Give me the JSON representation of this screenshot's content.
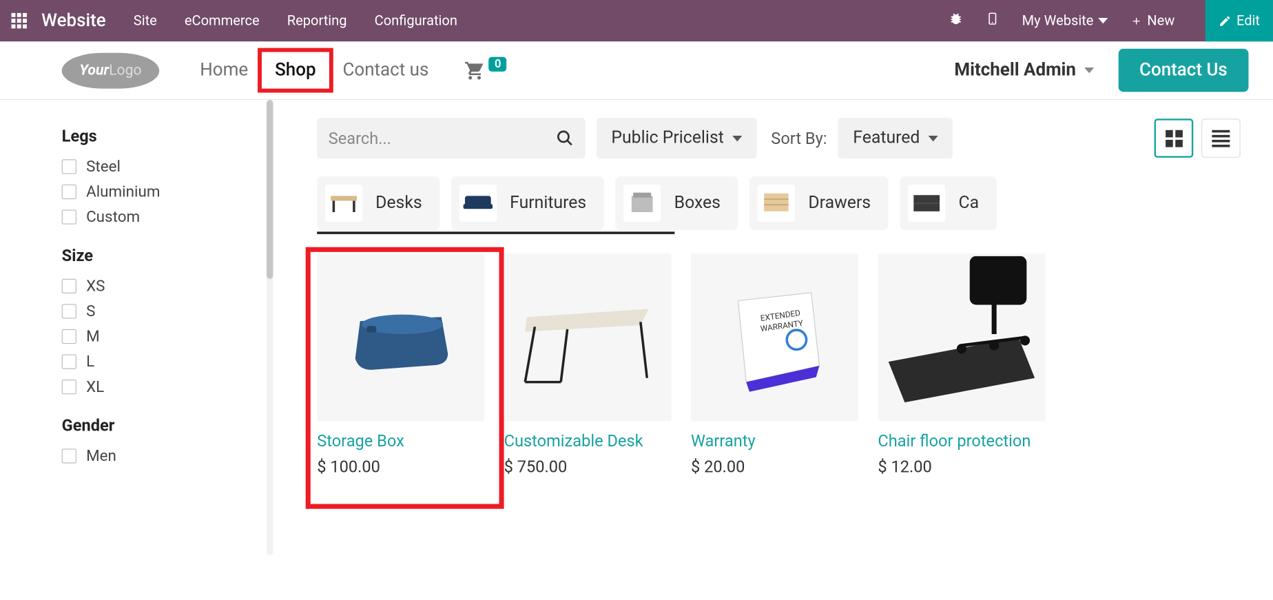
{
  "topbar": {
    "brand": "Website",
    "menu": [
      "Site",
      "eCommerce",
      "Reporting",
      "Configuration"
    ],
    "mysite": "My Website",
    "new": "New",
    "edit": "Edit"
  },
  "header": {
    "logo1": "Your",
    "logo2": "Logo",
    "nav": {
      "home": "Home",
      "shop": "Shop",
      "contact": "Contact us"
    },
    "cart_count": "0",
    "user": "Mitchell Admin",
    "contact_btn": "Contact Us"
  },
  "sidebar": {
    "groups": [
      {
        "title": "Legs",
        "opts": [
          "Steel",
          "Aluminium",
          "Custom"
        ]
      },
      {
        "title": "Size",
        "opts": [
          "XS",
          "S",
          "M",
          "L",
          "XL"
        ]
      },
      {
        "title": "Gender",
        "opts": [
          "Men"
        ]
      }
    ]
  },
  "toolbar": {
    "search_placeholder": "Search...",
    "pricelist": "Public Pricelist",
    "sort_label": "Sort By:",
    "sort_value": "Featured"
  },
  "categories": [
    {
      "label": "Desks"
    },
    {
      "label": "Furnitures"
    },
    {
      "label": "Boxes"
    },
    {
      "label": "Drawers"
    },
    {
      "label": "Ca"
    }
  ],
  "products": [
    {
      "title": "Storage Box",
      "price": "$ 100.00"
    },
    {
      "title": "Customizable Desk",
      "price": "$ 750.00"
    },
    {
      "title": "Warranty",
      "price": "$ 20.00"
    },
    {
      "title": "Chair floor protection",
      "price": "$ 12.00"
    }
  ]
}
